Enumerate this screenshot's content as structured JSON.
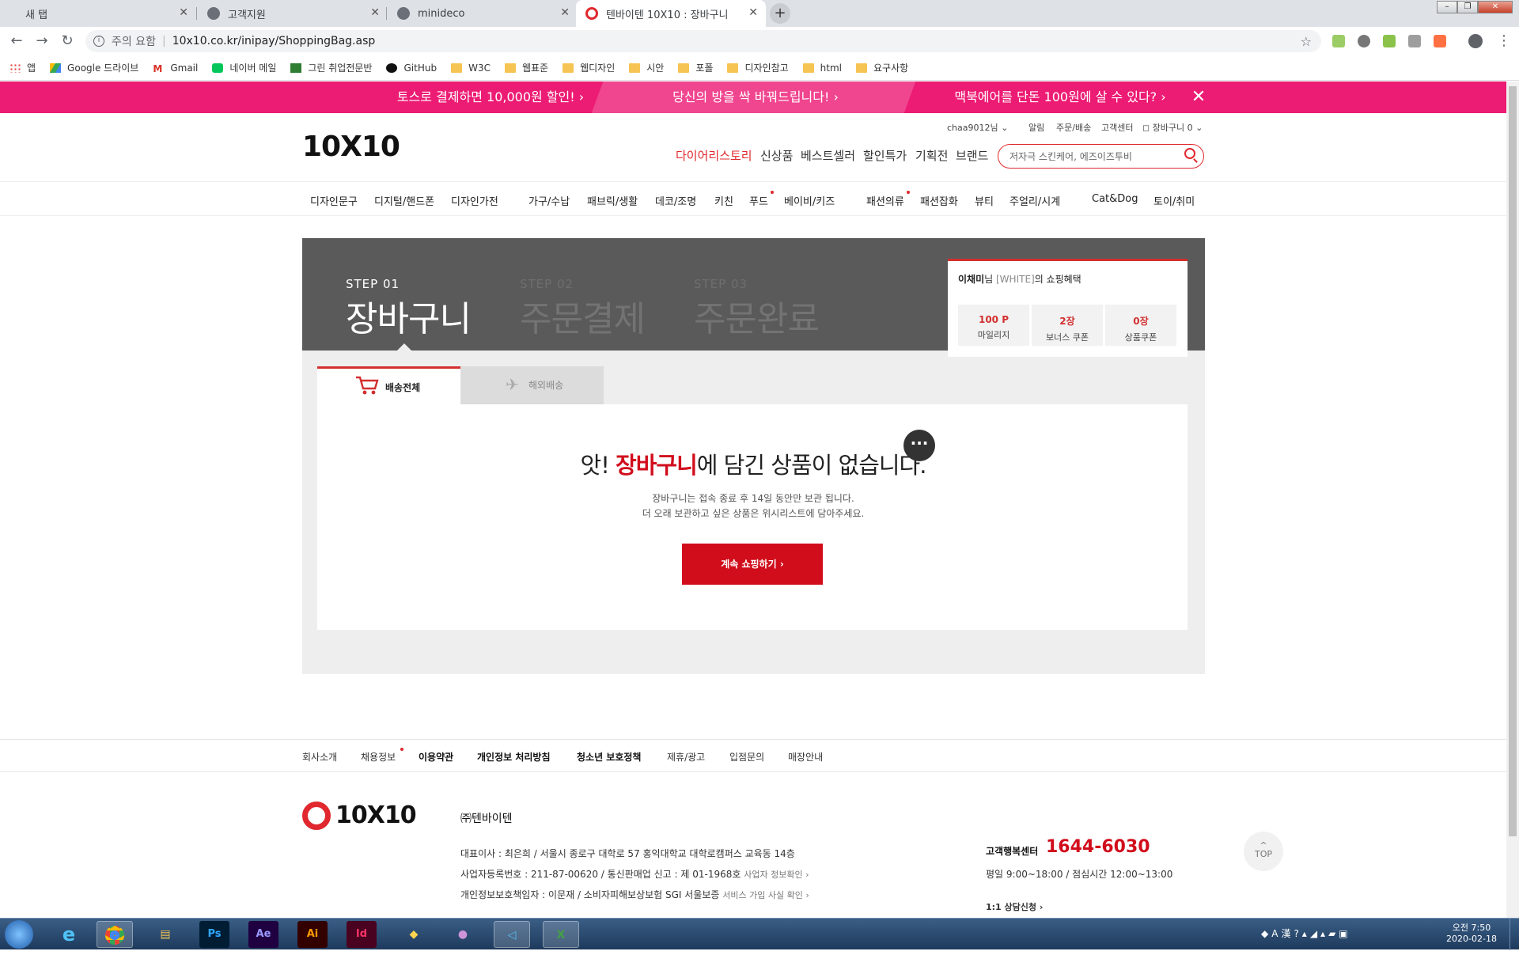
{
  "browser": {
    "tabs": [
      {
        "title": "새 탭"
      },
      {
        "title": "고객지원"
      },
      {
        "title": "minideco"
      },
      {
        "title": "텐바이텐 10X10 : 장바구니"
      }
    ],
    "address": {
      "security_label": "주의 요함",
      "url": "10x10.co.kr/inipay/ShoppingBag.asp"
    },
    "bookmarks": [
      "앱",
      "Google 드라이브",
      "Gmail",
      "네이버 메일",
      "그린 취업전문반",
      "GitHub",
      "W3C",
      "웹표준",
      "웹디자인",
      "시안",
      "포폴",
      "디자인참고",
      "html",
      "요구사항"
    ]
  },
  "promo": {
    "left": "토스로 결제하면 10,000원 할인! ›",
    "middle": "당신의 방을 싹 바꿔드립니다! ›",
    "right": "맥북에어를 단돈 100원에 살 수 있다? ›"
  },
  "header": {
    "logo": "10X10",
    "util": {
      "user": "chaa9012님 ⌄",
      "alarm": "알림",
      "order": "주문/배송",
      "cs": "고객센터",
      "cart": "장바구니 0 ⌄"
    },
    "nav": [
      "다이어리스토리",
      "신상품",
      "베스트셀러",
      "할인특가",
      "기획전",
      "브랜드"
    ],
    "search_placeholder": "저자극 스킨케어, 에즈이즈투비"
  },
  "categories": [
    "디자인문구",
    "디지털/핸드폰",
    "디자인가전",
    "가구/수납",
    "패브릭/생활",
    "데코/조명",
    "키친",
    "푸드",
    "베이비/키즈",
    "패션의류",
    "패션잡화",
    "뷰티",
    "주얼리/시계",
    "Cat&Dog",
    "토이/취미"
  ],
  "steps": [
    {
      "num": "STEP 01",
      "label": "장바구니"
    },
    {
      "num": "STEP 02",
      "label": "주문결제"
    },
    {
      "num": "STEP 03",
      "label": "주문완료"
    }
  ],
  "benefit": {
    "name": "이채미",
    "suffix": "님",
    "grade": "[WHITE]",
    "tail": "의 쇼핑혜택",
    "items": [
      {
        "value": "100 P",
        "label": "마일리지"
      },
      {
        "value": "2장",
        "label": "보너스 쿠폰"
      },
      {
        "value": "0장",
        "label": "상품쿠폰"
      }
    ]
  },
  "cart_tabs": {
    "all": "배송전체",
    "overseas": "해외배송"
  },
  "empty": {
    "pre": "앗! ",
    "highlight": "장바구니",
    "post": "에 담긴 상품이 없습니다.",
    "desc1": "장바구니는 접속 종료 후 14일 동안만 보관 됩니다.",
    "desc2": "더 오래 보관하고 싶은 상품은 위시리스트에 담아주세요.",
    "button": "계속 쇼핑하기 ›"
  },
  "footer": {
    "links": [
      "회사소개",
      "채용정보",
      "이용약관",
      "개인정보 처리방침",
      "청소년 보호정책",
      "제휴/광고",
      "입점문의",
      "매장안내"
    ],
    "company": "㈜텐바이텐",
    "line1": "대표이사 : 최은희 / 서울시 종로구 대학로 57 홍익대학교 대학로캠퍼스 교육동 14층",
    "line2": "사업자등록번호 : 211-87-00620 / 통신판매업 신고 : 제 01-1968호",
    "line2_link": "사업자 정보확인 ›",
    "line3": "개인정보보호책임자 : 이문재 / 소비자피해보상보험 SGI 서울보증",
    "line3_link": "서비스 가입 사실 확인 ›",
    "cs_label": "고객행복센터",
    "cs_phone": "1644-6030",
    "cs_hours": "평일 9:00~18:00 / 점심시간 12:00~13:00",
    "cs_chat": "1:1 상담신청 ›",
    "top": "TOP"
  },
  "taskbar": {
    "time": "오전 7:50",
    "date": "2020-02-18"
  }
}
